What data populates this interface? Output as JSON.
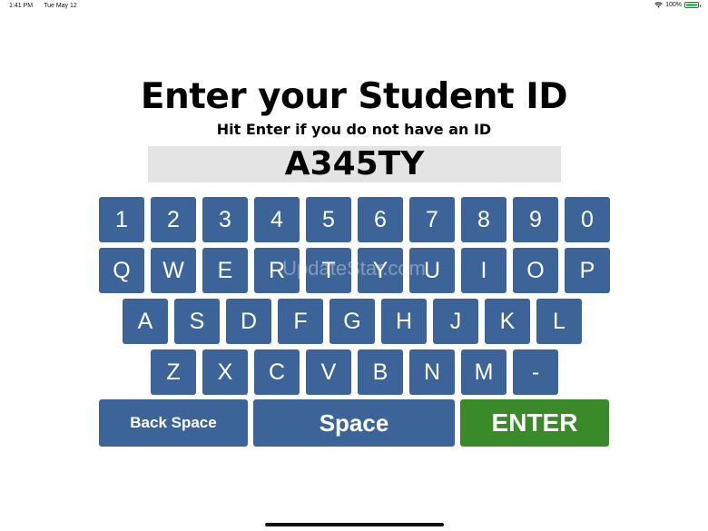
{
  "status_bar": {
    "time": "1:41 PM",
    "date": "Tue May 12",
    "battery": "100%"
  },
  "title": "Enter your Student ID",
  "subtitle": "Hit Enter if  you do not have an ID",
  "student_id_value": "A345TY",
  "keyboard": {
    "rows": [
      [
        "1",
        "2",
        "3",
        "4",
        "5",
        "6",
        "7",
        "8",
        "9",
        "0"
      ],
      [
        "Q",
        "W",
        "E",
        "R",
        "T",
        "Y",
        "U",
        "I",
        "O",
        "P"
      ],
      [
        "A",
        "S",
        "D",
        "F",
        "G",
        "H",
        "J",
        "K",
        "L"
      ],
      [
        "Z",
        "X",
        "C",
        "V",
        "B",
        "N",
        "M",
        "-"
      ]
    ],
    "backspace_label": "Back Space",
    "space_label": "Space",
    "enter_label": "ENTER"
  },
  "watermark": "UpdateStar.com",
  "colors": {
    "key": "#3d6498",
    "enter": "#3a8a2a",
    "field": "#e4e4e4"
  }
}
